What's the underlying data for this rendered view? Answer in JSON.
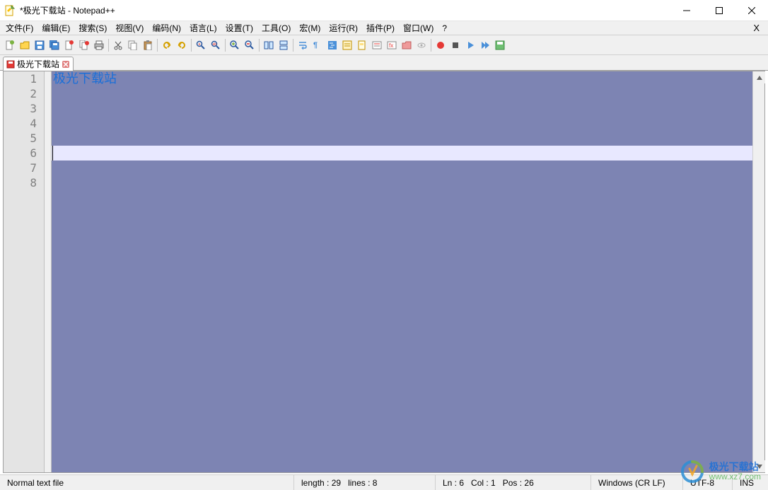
{
  "window": {
    "title": "*极光下载站 - Notepad++"
  },
  "menu": {
    "items": [
      "文件(F)",
      "编辑(E)",
      "搜索(S)",
      "视图(V)",
      "编码(N)",
      "语言(L)",
      "设置(T)",
      "工具(O)",
      "宏(M)",
      "运行(R)",
      "插件(P)",
      "窗口(W)",
      "?"
    ],
    "right": "X"
  },
  "toolbar": {
    "icons": [
      "new-file",
      "open-file",
      "save",
      "save-all",
      "close",
      "close-all",
      "print",
      "",
      "cut",
      "copy",
      "paste",
      "",
      "undo",
      "redo",
      "",
      "find",
      "replace",
      "",
      "zoom-in",
      "zoom-out",
      "",
      "sync-v",
      "sync-h",
      "",
      "word-wrap",
      "show-all",
      "indent-guide",
      "language",
      "doc-map",
      "doc-list",
      "func-list",
      "folder",
      "monitor",
      "",
      "record",
      "stop",
      "play",
      "play-multi",
      "save-macro"
    ]
  },
  "tab": {
    "label": "极光下载站"
  },
  "editor": {
    "line_count": 8,
    "lines": [
      "极光下载站",
      "",
      "",
      "",
      "",
      "",
      "",
      ""
    ],
    "current_line": 6
  },
  "status": {
    "filetype": "Normal text file",
    "length_label": "length : 29",
    "lines_label": "lines : 8",
    "ln_label": "Ln : 6",
    "col_label": "Col : 1",
    "pos_label": "Pos : 26",
    "eol": "Windows (CR LF)",
    "encoding": "UTF-8",
    "mode": "INS"
  },
  "watermark": {
    "title": "极光下载站",
    "url": "www.xz7.com"
  }
}
